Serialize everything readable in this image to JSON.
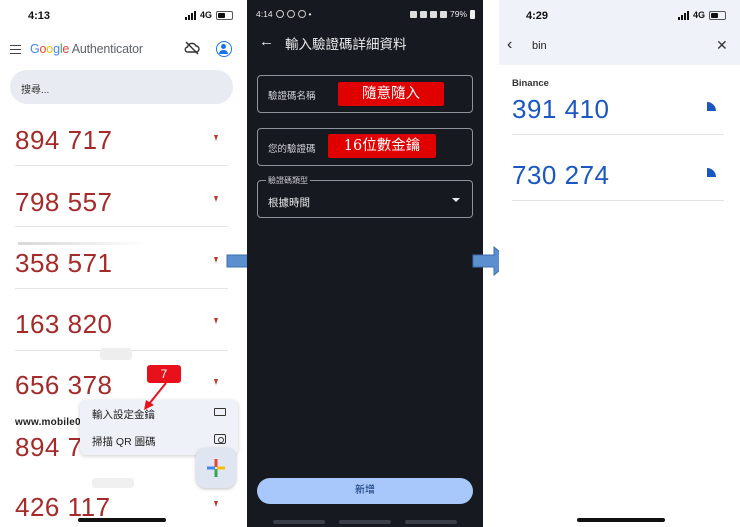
{
  "colors": {
    "code_red": "#a52a2a",
    "code_blue": "#1a57c3",
    "dark_bg": "#16191f",
    "callout_red": "#e00000",
    "flow_arrow": "#5b8fd0"
  },
  "panel1": {
    "status": {
      "time": "4:13",
      "network": "4G"
    },
    "app_title": {
      "g1": "G",
      "g2": "o",
      "g3": "o",
      "g1b": "g",
      "g4": "l",
      "g2b": "e",
      "rest": " Authenticator"
    },
    "search_placeholder": "搜尋...",
    "codes": [
      "894 717",
      "798 557",
      "358 571",
      "163 820",
      "656 378",
      "894 7",
      "426 117"
    ],
    "badge": "7",
    "watermark": "www.mobile0",
    "menu": {
      "item1": "輸入設定金鑰",
      "item2": "掃描 QR 圖碼"
    },
    "icons": [
      "menu-icon",
      "cloud-off-icon",
      "account-icon",
      "keyboard-icon",
      "camera-icon",
      "add-icon"
    ]
  },
  "panel2": {
    "status": {
      "time": "4:14",
      "battery": "79%"
    },
    "title": "輸入驗證碼詳細資料",
    "field1": {
      "label": "驗證碼名稱",
      "annotation": "隨意隨入"
    },
    "field2": {
      "label": "您的驗證碼",
      "annotation": "16位數金鑰"
    },
    "field3": {
      "legend": "驗證碼類型",
      "value": "根據時間"
    },
    "add_button": "新增"
  },
  "panel3": {
    "status": {
      "time": "4:29",
      "network": "4G"
    },
    "search_query": "bin",
    "issuer": "Binance",
    "codes": [
      "391 410",
      "730 274"
    ]
  }
}
